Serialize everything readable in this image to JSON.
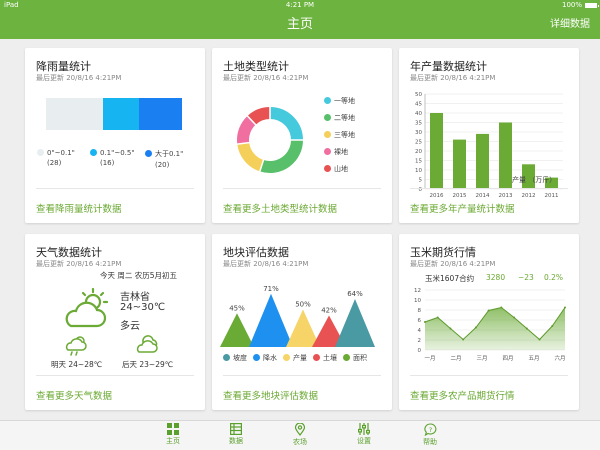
{
  "status": {
    "device": "iPad",
    "time": "4:21 PM",
    "battery": "100%"
  },
  "nav": {
    "title": "主页",
    "detail_label": "详细数据"
  },
  "colors": {
    "brand": "#6db33f",
    "link": "#6aa832"
  },
  "cards": {
    "rainfall": {
      "title": "降雨量统计",
      "updated": "最后更新 20/8/16 4:21PM",
      "link": "查看降雨量统计数据",
      "legend": [
        {
          "range": "0\"~0.1\"",
          "count": "(28)",
          "color": "#e8eef0"
        },
        {
          "range": "0.1\"~0.5\"",
          "count": "(16)",
          "color": "#16b4f0"
        },
        {
          "range": "大于0.1\"",
          "count": "(20)",
          "color": "#1a7ff0"
        }
      ]
    },
    "land": {
      "title": "土地类型统计",
      "updated": "最后更新 20/8/16 4:21PM",
      "link": "查看更多土地类型统计数据",
      "legend": [
        {
          "label": "一等地",
          "color": "#45c9dc"
        },
        {
          "label": "二等地",
          "color": "#58c06a"
        },
        {
          "label": "三等地",
          "color": "#f4cf5a"
        },
        {
          "label": "裸地",
          "color": "#f06fa0"
        },
        {
          "label": "山地",
          "color": "#e85252"
        }
      ]
    },
    "output": {
      "title": "年产量数据统计",
      "updated": "最后更新 20/8/16 4:21PM",
      "link": "查看更多年产量统计数据",
      "legend_label": "产量 （万斤）"
    },
    "weather": {
      "title": "天气数据统计",
      "updated": "最后更新 20/8/16 4:21PM",
      "link": "查看更多天气数据",
      "date_line": "今天  周二  农历5月初五",
      "location": "吉林省",
      "temp": "24~30℃",
      "condition": "多云",
      "tomorrow": "明天 24~28℃",
      "after": "后天 23~29℃",
      "icon": "partly-cloudy-icon"
    },
    "plot": {
      "title": "地块评估数据",
      "updated": "最后更新 20/8/16 4:21PM",
      "link": "查看更多地块评估数据"
    },
    "futures": {
      "title": "玉米期货行情",
      "updated": "最后更新 20/8/16 4:21PM",
      "link": "查看更多农产品期货行情",
      "contract": "玉米1607合约",
      "price": "3280",
      "change": "−23",
      "pct": "0.2%"
    }
  },
  "tabs": [
    {
      "label": "主页",
      "icon": "grid-icon"
    },
    {
      "label": "数据",
      "icon": "table-icon"
    },
    {
      "label": "农场",
      "icon": "location-pin-icon"
    },
    {
      "label": "设置",
      "icon": "sliders-icon"
    },
    {
      "label": "帮助",
      "icon": "help-bubble-icon"
    }
  ],
  "chart_data": [
    {
      "type": "bar",
      "stacked_horizontal": true,
      "categories": [
        "0\"~0.1\"",
        "0.1\"~0.5\"",
        "大于0.1\""
      ],
      "values": [
        28,
        16,
        20
      ],
      "colors": [
        "#e8eef0",
        "#16b4f0",
        "#1a7ff0"
      ]
    },
    {
      "type": "pie",
      "donut": true,
      "categories": [
        "一等地",
        "二等地",
        "三等地",
        "裸地",
        "山地"
      ],
      "values": [
        25,
        30,
        18,
        15,
        12
      ],
      "colors": [
        "#45c9dc",
        "#58c06a",
        "#f4cf5a",
        "#f06fa0",
        "#e85252"
      ]
    },
    {
      "type": "bar",
      "categories": [
        "2016",
        "2015",
        "2014",
        "2013",
        "2012",
        "2011"
      ],
      "series": [
        {
          "name": "产量 （万斤）",
          "values": [
            40,
            26,
            29,
            35,
            13,
            6
          ]
        }
      ],
      "ylim": [
        0,
        50
      ],
      "yticks": [
        "0",
        "5",
        "10",
        "15",
        "20",
        "25",
        "30",
        "35",
        "40",
        "45",
        "50"
      ],
      "color": "#6aaa35"
    },
    {
      "type": "area",
      "categories": [
        "坡度",
        "降水",
        "产量",
        "土壤",
        "面积"
      ],
      "values": [
        45,
        71,
        50,
        42,
        64
      ],
      "value_labels": [
        "45%",
        "71%",
        "50%",
        "42%",
        "64%"
      ],
      "colors": [
        "#6aab36",
        "#1e90f0",
        "#f6d468",
        "#e85252",
        "#4a9aa4"
      ],
      "ylim": [
        0,
        100
      ]
    },
    {
      "type": "area",
      "categories": [
        "一月",
        "二月",
        "三月",
        "四月",
        "五月",
        "六月"
      ],
      "x": [
        0,
        0.5,
        1,
        1.5,
        2,
        2.5,
        3,
        3.5,
        4,
        4.5,
        5,
        5.5
      ],
      "values": [
        5.6,
        6.5,
        4.3,
        2.1,
        4.5,
        7.9,
        8.5,
        6.5,
        4.3,
        2.1,
        4.8,
        8.5
      ],
      "ylim": [
        0,
        12
      ],
      "yticks": [
        "0",
        "2",
        "4",
        "6",
        "8",
        "10",
        "12"
      ],
      "color": "#6aaa35"
    }
  ]
}
